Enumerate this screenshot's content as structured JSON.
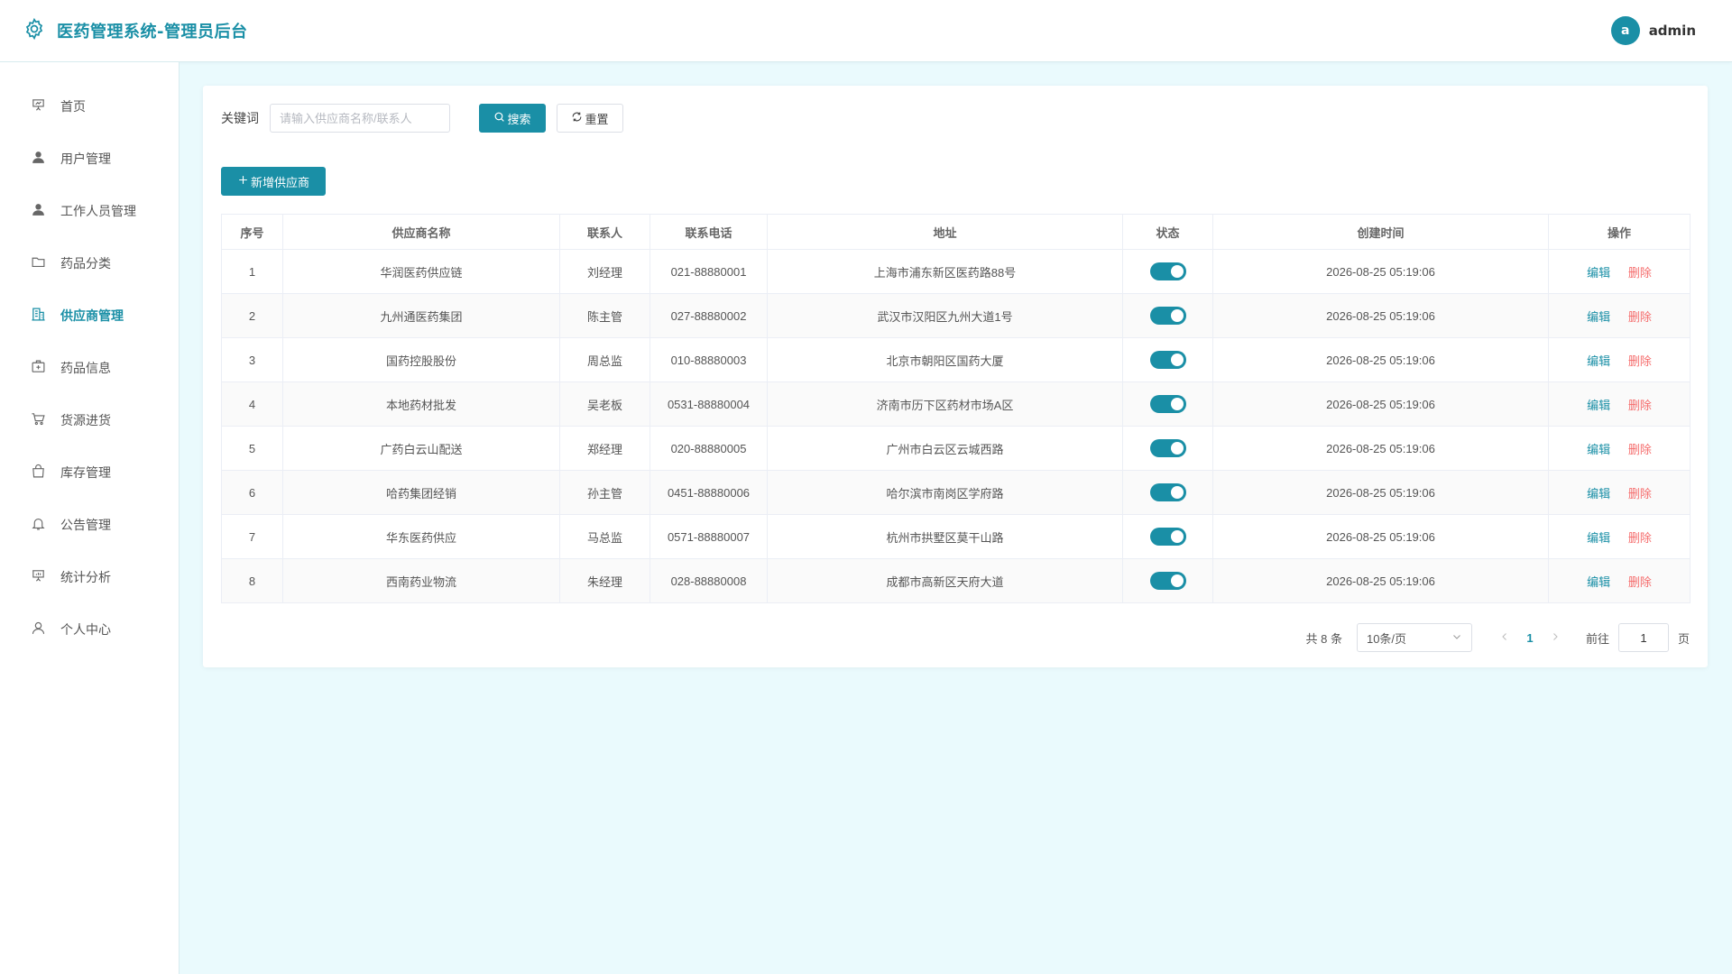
{
  "app": {
    "title": "医药管理系统-管理员后台"
  },
  "user": {
    "avatar_letter": "a",
    "name": "admin"
  },
  "sidebar": {
    "items": [
      {
        "label": "首页",
        "icon": "presentation-board-icon",
        "active": false
      },
      {
        "label": "用户管理",
        "icon": "user-filled-icon",
        "active": false
      },
      {
        "label": "工作人员管理",
        "icon": "user-filled-icon",
        "active": false
      },
      {
        "label": "药品分类",
        "icon": "folder-icon",
        "active": false
      },
      {
        "label": "供应商管理",
        "icon": "office-building-icon",
        "active": true
      },
      {
        "label": "药品信息",
        "icon": "first-aid-kit-icon",
        "active": false
      },
      {
        "label": "货源进货",
        "icon": "shopping-cart-icon",
        "active": false
      },
      {
        "label": "库存管理",
        "icon": "shopping-bag-icon",
        "active": false
      },
      {
        "label": "公告管理",
        "icon": "bell-icon",
        "active": false
      },
      {
        "label": "统计分析",
        "icon": "chart-board-icon",
        "active": false
      },
      {
        "label": "个人中心",
        "icon": "user-outline-icon",
        "active": false
      }
    ]
  },
  "search": {
    "label": "关键词",
    "placeholder": "请输入供应商名称/联系人",
    "value": "",
    "search_label": "搜索",
    "reset_label": "重置"
  },
  "toolbar": {
    "add_label": "新增供应商"
  },
  "table": {
    "headers": [
      "序号",
      "供应商名称",
      "联系人",
      "联系电话",
      "地址",
      "状态",
      "创建时间",
      "操作"
    ],
    "rows": [
      {
        "no": "1",
        "name": "华润医药供应链",
        "contact": "刘经理",
        "phone": "021-88880001",
        "address": "上海市浦东新区医药路88号",
        "enabled": true,
        "created": "2026-08-25 05:19:06"
      },
      {
        "no": "2",
        "name": "九州通医药集团",
        "contact": "陈主管",
        "phone": "027-88880002",
        "address": "武汉市汉阳区九州大道1号",
        "enabled": true,
        "created": "2026-08-25 05:19:06"
      },
      {
        "no": "3",
        "name": "国药控股股份",
        "contact": "周总监",
        "phone": "010-88880003",
        "address": "北京市朝阳区国药大厦",
        "enabled": true,
        "created": "2026-08-25 05:19:06"
      },
      {
        "no": "4",
        "name": "本地药材批发",
        "contact": "吴老板",
        "phone": "0531-88880004",
        "address": "济南市历下区药材市场A区",
        "enabled": true,
        "created": "2026-08-25 05:19:06"
      },
      {
        "no": "5",
        "name": "广药白云山配送",
        "contact": "郑经理",
        "phone": "020-88880005",
        "address": "广州市白云区云城西路",
        "enabled": true,
        "created": "2026-08-25 05:19:06"
      },
      {
        "no": "6",
        "name": "哈药集团经销",
        "contact": "孙主管",
        "phone": "0451-88880006",
        "address": "哈尔滨市南岗区学府路",
        "enabled": true,
        "created": "2026-08-25 05:19:06"
      },
      {
        "no": "7",
        "name": "华东医药供应",
        "contact": "马总监",
        "phone": "0571-88880007",
        "address": "杭州市拱墅区莫干山路",
        "enabled": true,
        "created": "2026-08-25 05:19:06"
      },
      {
        "no": "8",
        "name": "西南药业物流",
        "contact": "朱经理",
        "phone": "028-88880008",
        "address": "成都市高新区天府大道",
        "enabled": true,
        "created": "2026-08-25 05:19:06"
      }
    ],
    "edit_label": "编辑",
    "delete_label": "删除"
  },
  "pagination": {
    "total_text": "共 8 条",
    "page_size": "10条/页",
    "current_page": "1",
    "goto_label": "前往",
    "goto_value": "1",
    "page_unit": "页"
  },
  "colors": {
    "primary": "#1a8fa6",
    "danger": "#f56c6c",
    "background": "#eafafd"
  }
}
